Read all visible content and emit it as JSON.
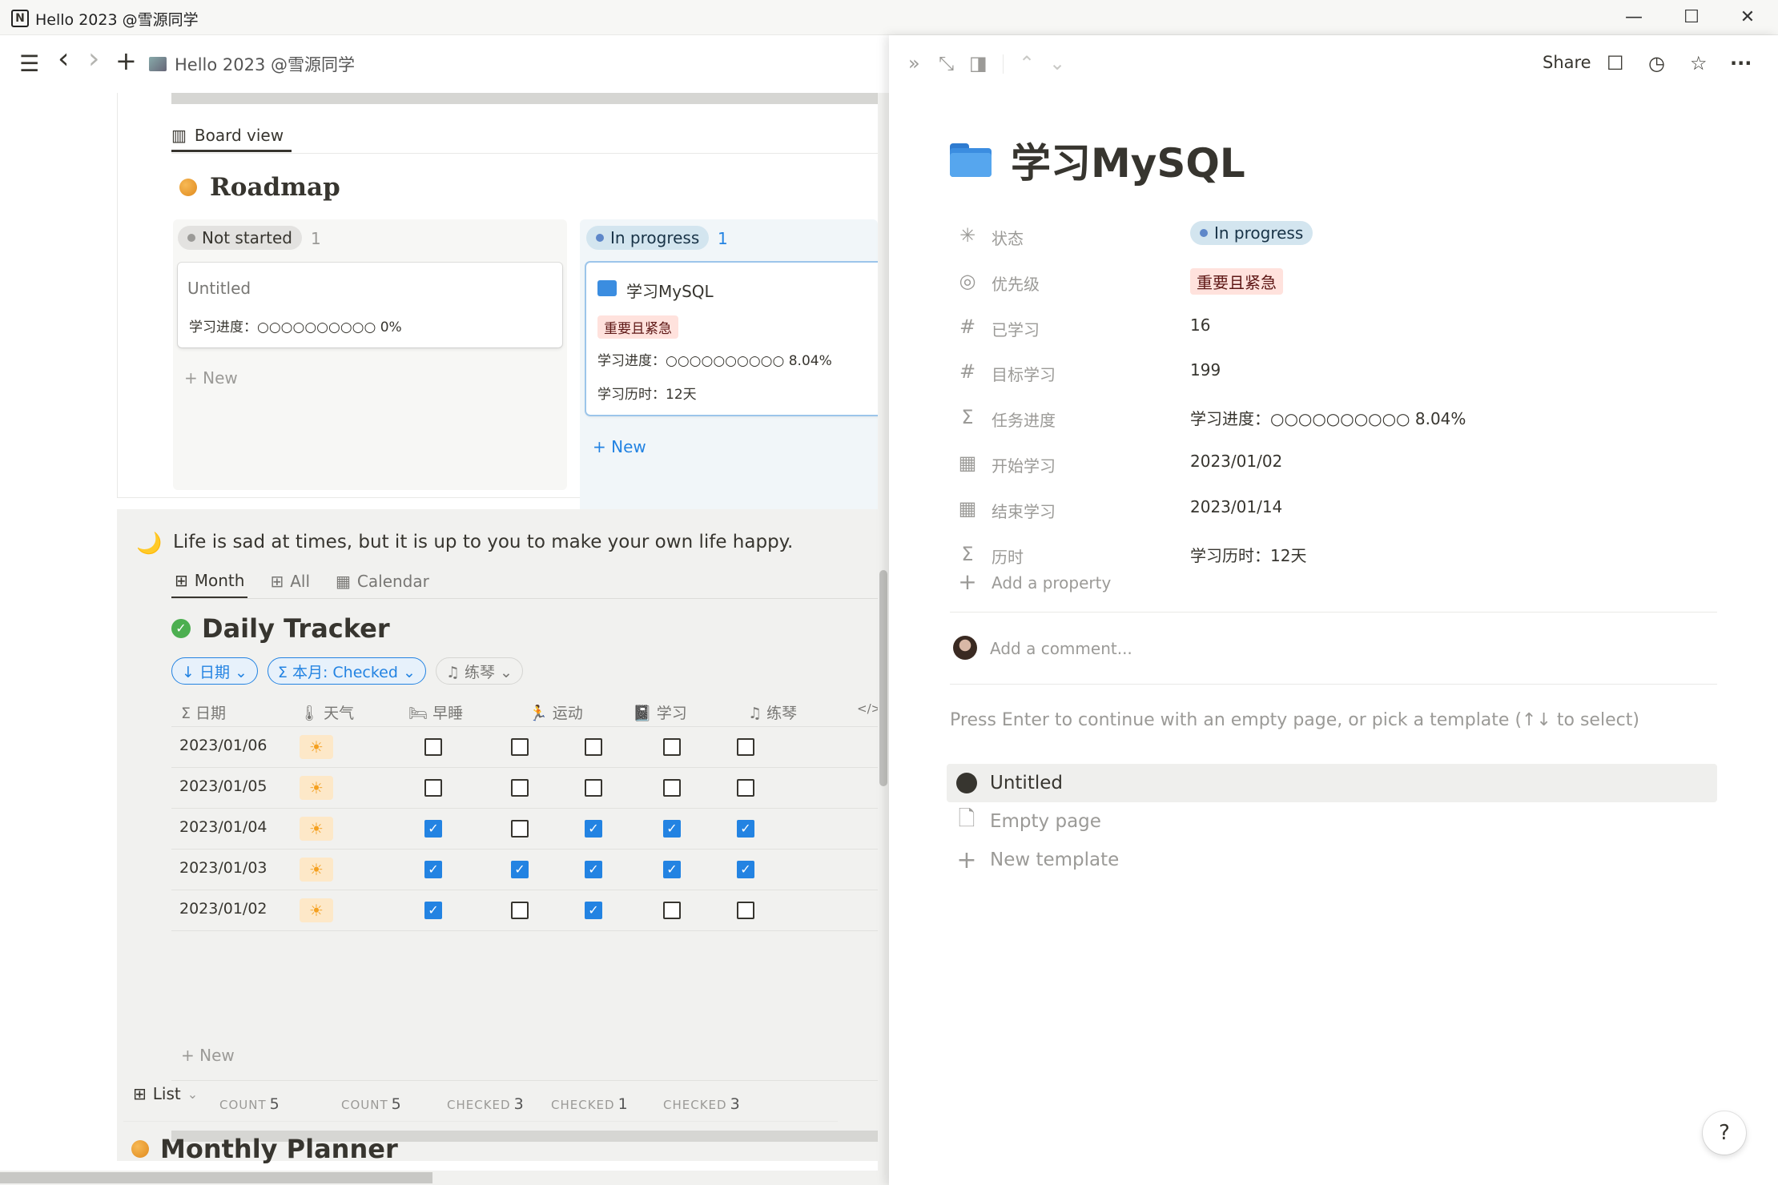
{
  "window": {
    "title": "Hello 2023 @雪源同学",
    "minimize": "—",
    "maximize": "☐",
    "close": "✕"
  },
  "nav": {
    "menu_icon": "☰",
    "back_icon": "‹",
    "forward_icon": "›",
    "new_icon": "+",
    "breadcrumb": "Hello 2023 @雪源同学"
  },
  "board": {
    "view_label": "Board view",
    "title": "Roadmap",
    "columns": [
      {
        "status": "Not started",
        "count": "1",
        "color": "#9b9a97"
      },
      {
        "status": "In progress",
        "count": "1",
        "color": "#5e87c9"
      }
    ],
    "cards": [
      {
        "title": "Untitled",
        "progress": "学习进度：○○○○○○○○○○ 0%"
      },
      {
        "title": "学习MySQL",
        "tag": "重要且紧急",
        "progress": "学习进度：○○○○○○○○○○ 8.04%",
        "duration": "学习历时：12天"
      }
    ],
    "new_label": "New"
  },
  "tracker": {
    "quote": "Life is sad at times, but it is up to you to make your own life happy.",
    "tabs": [
      {
        "label": "Month",
        "icon": "⊞"
      },
      {
        "label": "All",
        "icon": "⊞"
      },
      {
        "label": "Calendar",
        "icon": "▦"
      }
    ],
    "title": "Daily Tracker",
    "filters": [
      "↓ 日期 ⌄",
      "Σ 本月: Checked ⌄",
      "♫ 练琴 ⌄"
    ],
    "columns": [
      "Σ 日期",
      "🌡 天气",
      "🛏 早睡",
      "🏃 运动",
      "📓 学习",
      "♫ 练琴",
      "</>"
    ],
    "rows": [
      {
        "date": "2023/01/06",
        "weather": "☀",
        "checks": [
          false,
          false,
          false,
          false,
          false
        ]
      },
      {
        "date": "2023/01/05",
        "weather": "☀",
        "checks": [
          false,
          false,
          false,
          false,
          false
        ]
      },
      {
        "date": "2023/01/04",
        "weather": "☀",
        "checks": [
          true,
          false,
          true,
          true,
          true
        ]
      },
      {
        "date": "2023/01/03",
        "weather": "☀",
        "checks": [
          true,
          true,
          true,
          true,
          true
        ]
      },
      {
        "date": "2023/01/02",
        "weather": "☀",
        "checks": [
          true,
          false,
          true,
          false,
          false
        ]
      }
    ],
    "new_label": "New",
    "footer": [
      {
        "label": "COUNT",
        "value": "5"
      },
      {
        "label": "COUNT",
        "value": "5"
      },
      {
        "label": "CHECKED",
        "value": "3"
      },
      {
        "label": "CHECKED",
        "value": "1"
      },
      {
        "label": "CHECKED",
        "value": "3"
      }
    ]
  },
  "planner": {
    "view_label": "List",
    "title": "Monthly Planner"
  },
  "peek": {
    "share_label": "Share",
    "page_title": "学习MySQL",
    "properties": [
      {
        "icon": "✳",
        "name": "状态",
        "value": "In progress",
        "kind": "status"
      },
      {
        "icon": "◎",
        "name": "优先级",
        "value": "重要且紧急",
        "kind": "tag"
      },
      {
        "icon": "#",
        "name": "已学习",
        "value": "16",
        "kind": "text"
      },
      {
        "icon": "#",
        "name": "目标学习",
        "value": "199",
        "kind": "text"
      },
      {
        "icon": "Σ",
        "name": "任务进度",
        "value": "学习进度：○○○○○○○○○○ 8.04%",
        "kind": "text"
      },
      {
        "icon": "▦",
        "name": "开始学习",
        "value": "2023/01/02",
        "kind": "text"
      },
      {
        "icon": "▦",
        "name": "结束学习",
        "value": "2023/01/14",
        "kind": "text"
      },
      {
        "icon": "Σ",
        "name": "历时",
        "value": "学习历时：12天",
        "kind": "text"
      }
    ],
    "add_property": "Add a property",
    "comment_placeholder": "Add a comment...",
    "template_hint": "Press Enter to continue with an empty page, or pick a template (↑↓ to select)",
    "templates": [
      "Untitled",
      "Empty page",
      "New template"
    ],
    "help_label": "?"
  },
  "colors": {
    "accent": "#2383e2",
    "tag_red_bg": "#ffe2dd",
    "status_blue_bg": "#d3e5ef"
  }
}
